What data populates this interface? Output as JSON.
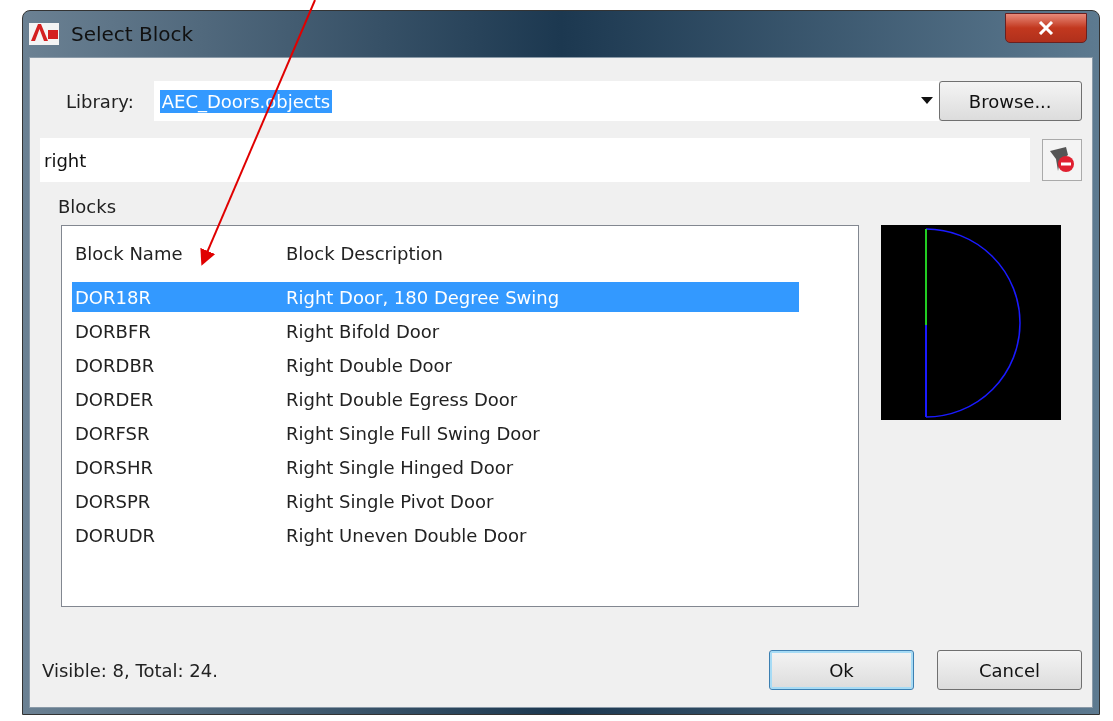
{
  "window": {
    "title": "Select Block"
  },
  "library": {
    "label": "Library:",
    "value": "AEC_Doors.objects",
    "value_highlighted": true,
    "browse": "Browse..."
  },
  "search": {
    "value": "right"
  },
  "blocks": {
    "label": "Blocks",
    "columns": [
      "Block Name",
      "Block Description"
    ],
    "rows": [
      {
        "name": "DOR18R",
        "description": "Right Door, 180 Degree Swing",
        "selected": true
      },
      {
        "name": "DORBFR",
        "description": "Right Bifold Door",
        "selected": false
      },
      {
        "name": "DORDBR",
        "description": "Right Double Door",
        "selected": false
      },
      {
        "name": "DORDER",
        "description": "Right Double Egress Door",
        "selected": false
      },
      {
        "name": "DORFSR",
        "description": "Right Single Full Swing Door",
        "selected": false
      },
      {
        "name": "DORSHR",
        "description": "Right Single Hinged Door",
        "selected": false
      },
      {
        "name": "DORSPR",
        "description": "Right Single Pivot Door",
        "selected": false
      },
      {
        "name": "DORUDR",
        "description": "Right Uneven Double Door",
        "selected": false
      }
    ]
  },
  "status_bar": "Visible: 8, Total: 24.",
  "buttons": [
    {
      "label": "Ok",
      "default": true
    },
    {
      "label": "Cancel",
      "default": false
    }
  ]
}
